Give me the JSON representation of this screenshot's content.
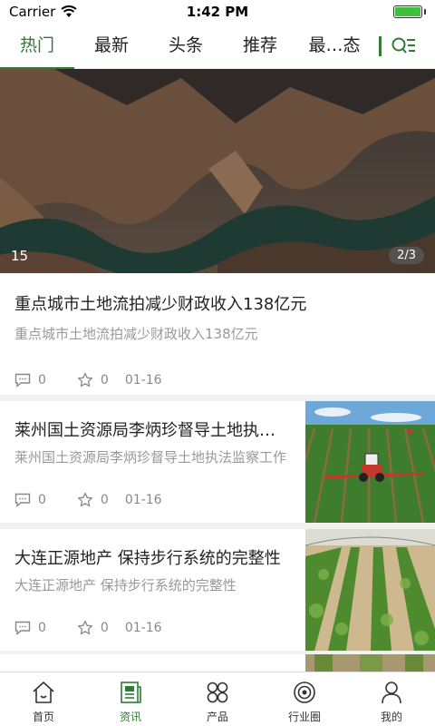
{
  "status": {
    "carrier": "Carrier",
    "time": "1:42 PM"
  },
  "tabs": [
    {
      "label": "热门",
      "active": true
    },
    {
      "label": "最新",
      "active": false
    },
    {
      "label": "头条",
      "active": false
    },
    {
      "label": "推荐",
      "active": false
    },
    {
      "label": "最…态",
      "active": false
    }
  ],
  "hero": {
    "counter": "15",
    "page": "2/3"
  },
  "feature": {
    "title": "重点城市土地流拍减少财政收入138亿元",
    "summary": "重点城市土地流拍减少财政收入138亿元",
    "comments": "0",
    "likes": "0",
    "date": "01-16"
  },
  "cards": [
    {
      "title": "莱州国土资源局李炳珍督导土地执法监察工作",
      "summary": "莱州国土资源局李炳珍督导土地执法监察工作",
      "comments": "0",
      "likes": "0",
      "date": "01-16"
    },
    {
      "title": "大连正源地产 保持步行系统的完整性",
      "summary": "大连正源地产 保持步行系统的完整性",
      "comments": "0",
      "likes": "0",
      "date": "01-16"
    }
  ],
  "nav": [
    {
      "label": "首页",
      "icon": "home-icon",
      "active": false
    },
    {
      "label": "资讯",
      "icon": "news-icon",
      "active": true
    },
    {
      "label": "产品",
      "icon": "products-icon",
      "active": false
    },
    {
      "label": "行业圈",
      "icon": "industry-circle-icon",
      "active": false
    },
    {
      "label": "我的",
      "icon": "profile-icon",
      "active": false
    }
  ],
  "colors": {
    "accent": "#2e7d32",
    "battery": "#3cc13b"
  }
}
